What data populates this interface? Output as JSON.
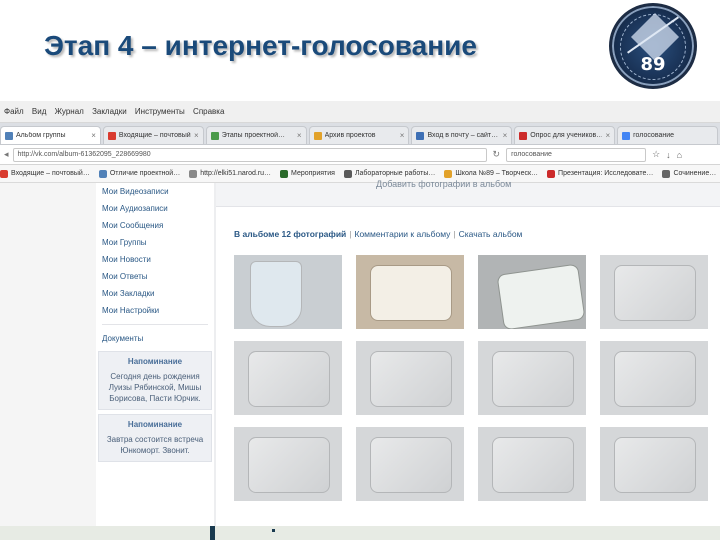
{
  "slide": {
    "title": "Этап 4 – интернет-голосование",
    "logo_number": "89"
  },
  "browser": {
    "menu": [
      "Файл",
      "Вид",
      "Журнал",
      "Закладки",
      "Инструменты",
      "Справка"
    ],
    "tabs": [
      {
        "label": "Альбом группы",
        "active": true,
        "color": "#5181b8"
      },
      {
        "label": "Входящие – почтовый…",
        "active": false,
        "color": "#d93b2f"
      },
      {
        "label": "Этапы проектной…",
        "active": false,
        "color": "#4a9a4a"
      },
      {
        "label": "Архив проектов",
        "active": false,
        "color": "#e2a22a"
      },
      {
        "label": "Вход в почту – сайт…",
        "active": false,
        "color": "#3d6fb5"
      },
      {
        "label": "Опрос для учеников…",
        "active": false,
        "color": "#cc2a2a"
      },
      {
        "label": "голосование",
        "active": false,
        "color": "#4285f4"
      }
    ],
    "url": "http://vk.com/album-61362095_228669980",
    "search_placeholder": "голосование",
    "bookmarks": [
      {
        "label": "Входящие – почтовый…",
        "color": "#d93b2f"
      },
      {
        "label": "Отличие проектной…",
        "color": "#5181b8"
      },
      {
        "label": "http://elki51.narod.ru…",
        "color": "#888888"
      },
      {
        "label": "Мероприятия",
        "color": "#2a6a2a"
      },
      {
        "label": "Лабораторные работы…",
        "color": "#5a5a5a"
      },
      {
        "label": "Школа №89 – Творческ…",
        "color": "#e2a22a"
      },
      {
        "label": "Презентация: Исследовате…",
        "color": "#cc2a2a"
      },
      {
        "label": "Сочинение…",
        "color": "#666666"
      }
    ]
  },
  "vk": {
    "left_menu": [
      "Мои Видеозаписи",
      "Мои Аудиозаписи",
      "Мои Сообщения",
      "Мои Группы",
      "Мои Новости",
      "Мои Ответы",
      "Мои Закладки",
      "Мои Настройки"
    ],
    "documents_label": "Документы",
    "notices": [
      {
        "title": "Напоминание",
        "body": "Сегодня день рождения Луизы Рябинской, Мишы Борисова, Пасти Юрчик."
      },
      {
        "title": "Напоминание",
        "body": "Завтра состоится встреча Юнкоморт. Звонит."
      }
    ],
    "add_photos_label": "Добавить фотографии в альбом",
    "album_count_label": "В альбоме 12 фотографий",
    "album_comments_label": "Комментарии к альбому",
    "album_download_label": "Скачать альбом",
    "photos": [
      "photo-1",
      "photo-2",
      "photo-3",
      "photo-4",
      "photo-5",
      "photo-6",
      "photo-7",
      "photo-8",
      "photo-9",
      "photo-10",
      "photo-11",
      "photo-12"
    ]
  }
}
